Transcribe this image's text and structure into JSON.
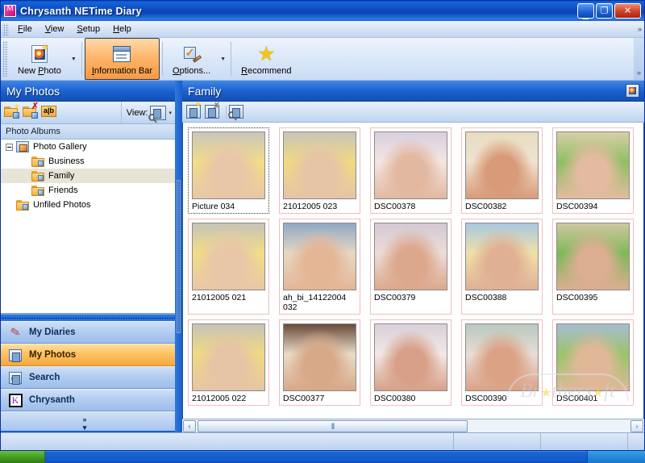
{
  "window": {
    "title": "Chrysanth NETime Diary",
    "app_icon": "chrysanth-logo-icon",
    "minimize_label": "_",
    "maximize_label": "❐",
    "close_label": "✕"
  },
  "menubar": {
    "items": [
      {
        "label": "File",
        "mnemonic": "F"
      },
      {
        "label": "View",
        "mnemonic": "V"
      },
      {
        "label": "Setup",
        "mnemonic": "S"
      },
      {
        "label": "Help",
        "mnemonic": "H"
      }
    ],
    "overflow": "»"
  },
  "toolbar": {
    "buttons": [
      {
        "label": "New Photo",
        "mnemonic": "P",
        "icon": "new-photo-icon",
        "has_dropdown": true,
        "active": false
      },
      {
        "label": "Information Bar",
        "mnemonic": "I",
        "icon": "information-bar-icon",
        "has_dropdown": false,
        "active": true
      },
      {
        "label": "Options...",
        "mnemonic": "O",
        "icon": "options-icon",
        "has_dropdown": true,
        "active": false
      },
      {
        "label": "Recommend",
        "mnemonic": "R",
        "icon": "recommend-star-icon",
        "has_dropdown": false,
        "active": false
      }
    ],
    "overflow": "»"
  },
  "left_pane": {
    "header": "My Photos",
    "toolbar": {
      "new_album": "new-album-icon",
      "delete_album": "delete-album-icon",
      "rename_album": "rename-album-icon",
      "view_label": "View:",
      "view_icon": "view-mode-icon",
      "view_dropdown": "▾"
    },
    "section_title": "Photo Albums",
    "tree": [
      {
        "label": "Photo Gallery",
        "level": 0,
        "icon": "gallery-icon",
        "expanded": true,
        "selected": false
      },
      {
        "label": "Business",
        "level": 1,
        "icon": "album-folder-icon",
        "selected": false
      },
      {
        "label": "Family",
        "level": 1,
        "icon": "album-folder-icon",
        "selected": true
      },
      {
        "label": "Friends",
        "level": 1,
        "icon": "album-folder-icon",
        "selected": false
      },
      {
        "label": "Unfiled Photos",
        "level": 0,
        "icon": "unfiled-folder-icon",
        "selected": false
      }
    ]
  },
  "nav": {
    "items": [
      {
        "label": "My Diaries",
        "icon": "diary-pen-icon",
        "selected": false
      },
      {
        "label": "My Photos",
        "icon": "photos-icon",
        "selected": true
      },
      {
        "label": "Search",
        "icon": "search-magnifier-icon",
        "selected": false
      },
      {
        "label": "Chrysanth",
        "icon": "chrysanth-icon",
        "selected": false
      }
    ],
    "more_chevron": "»",
    "more_arrow": "▾"
  },
  "right_pane": {
    "header": "Family",
    "header_icon": "album-photo-icon",
    "toolbar": {
      "add_photo": "add-photo-icon",
      "delete_photo": "delete-photo-icon",
      "find_photo": "find-photo-icon"
    },
    "photos": [
      {
        "caption": "Picture 034",
        "focused": true,
        "c1": "#c9c6bb",
        "c2": "#f2dd86",
        "c3": "#e8c6a8"
      },
      {
        "caption": "21012005 023",
        "focused": false,
        "c1": "#c8c5ba",
        "c2": "#f0da80",
        "c3": "#e6c4a6"
      },
      {
        "caption": "DSC00378",
        "focused": false,
        "c1": "#d8cfe0",
        "c2": "#f4e6e2",
        "c3": "#e2b8a0"
      },
      {
        "caption": "DSC00382",
        "focused": false,
        "c1": "#e8dcc0",
        "c2": "#f0e2d0",
        "c3": "#d89a78"
      },
      {
        "caption": "DSC00394",
        "focused": false,
        "c1": "#d8cfa8",
        "c2": "#8fbf62",
        "c3": "#e4bba0"
      },
      {
        "caption": "21012005 021",
        "focused": false,
        "c1": "#c6c3b8",
        "c2": "#f2dd86",
        "c3": "#e8c6a8"
      },
      {
        "caption": "ah_bi_14122004 032",
        "focused": false,
        "c1": "#8fa8c4",
        "c2": "#e6d8c4",
        "c3": "#e4b696"
      },
      {
        "caption": "DSC00379",
        "focused": false,
        "c1": "#d4c8d4",
        "c2": "#ecdcd8",
        "c3": "#dca88c"
      },
      {
        "caption": "DSC00388",
        "focused": false,
        "c1": "#a8c8e0",
        "c2": "#f0e0a8",
        "c3": "#e0b094"
      },
      {
        "caption": "DSC00395",
        "focused": false,
        "c1": "#cfc8a0",
        "c2": "#7fb858",
        "c3": "#dcae92"
      },
      {
        "caption": "21012005 022",
        "focused": false,
        "c1": "#c6c3b8",
        "c2": "#f0da80",
        "c3": "#e6c4a6"
      },
      {
        "caption": "DSC00377",
        "focused": false,
        "c1": "#6a4a3a",
        "c2": "#e8dcc8",
        "c3": "#d8a888"
      },
      {
        "caption": "DSC00380",
        "focused": false,
        "c1": "#d8d0d8",
        "c2": "#f2e8e6",
        "c3": "#d8a088"
      },
      {
        "caption": "DSC00390",
        "focused": false,
        "c1": "#b8c8c0",
        "c2": "#e8ddd4",
        "c3": "#dba286"
      },
      {
        "caption": "DSC00401",
        "focused": false,
        "c1": "#a8bcd0",
        "c2": "#9ac46a",
        "c3": "#e0b898"
      }
    ],
    "hscroll": {
      "left_arrow": "‹",
      "right_arrow": "›"
    }
  },
  "watermark": {
    "text_before": "Br",
    "text_middle": "thers",
    "text_after": "ft",
    "star": "★"
  },
  "statusbar": {
    "pane1": "",
    "pane2": "",
    "pane3": ""
  },
  "colors": {
    "title_blue": "#0a44b3",
    "accent_orange": "#f6a83e",
    "selection_beige": "#e8e4d6",
    "thumb_border_pink": "#f0bfc0"
  }
}
